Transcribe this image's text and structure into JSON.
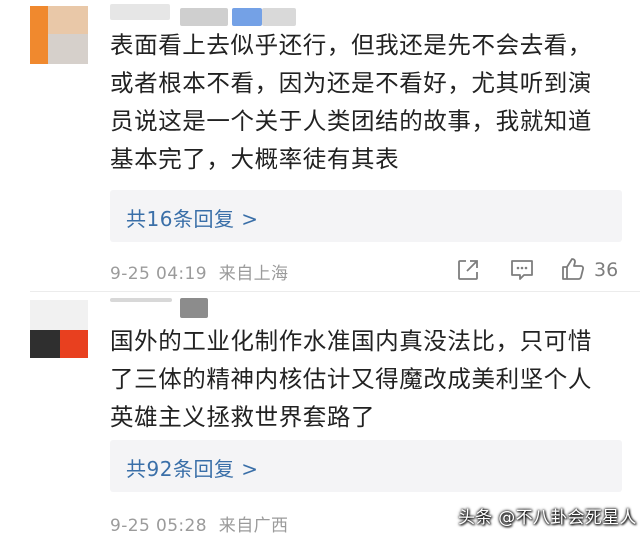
{
  "comments": [
    {
      "text": "表面看上去似乎还行，但我还是先不会去看，\n或者根本不看，因为还是不看好，尤其听到演\n员说这是一个关于人类团结的故事，我就知道\n基本完了，大概率徒有其表",
      "reply_label": "共16条回复 >",
      "time": "9-25 04:19",
      "location": "来自上海",
      "likes": "36"
    },
    {
      "text": "国外的工业化制作水准国内真没法比，只可惜\n了三体的精神内核估计又得魔改成美利坚个人\n英雄主义拯救世界套路了",
      "reply_label": "共92条回复 >",
      "time": "9-25 05:28",
      "location": "来自广西"
    }
  ],
  "icons": {
    "share": "share-icon",
    "comment": "comment-icon",
    "like": "thumbs-up-icon"
  },
  "watermark": "头条 @不八卦会死星人",
  "colors": {
    "link": "#3a6fa8",
    "reply_bg": "#f4f4f6",
    "meta": "#9b9b9b"
  }
}
